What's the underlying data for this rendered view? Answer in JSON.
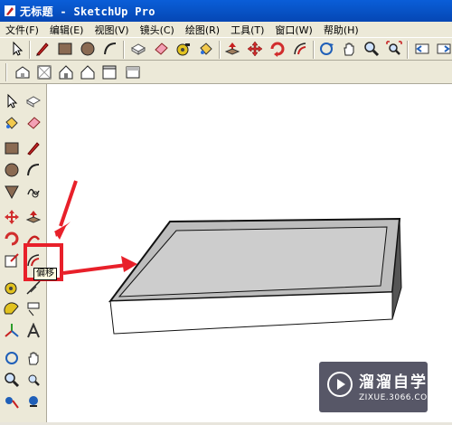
{
  "window": {
    "title": "无标题 - SketchUp Pro"
  },
  "menu": [
    "文件(F)",
    "编辑(E)",
    "视图(V)",
    "镜头(C)",
    "绘图(R)",
    "工具(T)",
    "窗口(W)",
    "帮助(H)"
  ],
  "tooltip": {
    "text": "偏移"
  },
  "watermark": {
    "title": "溜溜自学",
    "url": "ZIXUE.3066.COM"
  },
  "colors": {
    "titlebar": "#0547b4",
    "highlight": "#e8202a",
    "arrow": "#e8202a"
  },
  "toolbar_top_icons": [
    "select-icon",
    "pencil-icon",
    "rectangle-icon",
    "circle-icon",
    "arc-icon",
    "make-component-icon",
    "eraser-icon",
    "paint-bucket-icon",
    "push-pull-icon",
    "move-icon",
    "rotate-icon",
    "offset-icon",
    "orbit-icon",
    "pan-icon",
    "zoom-icon",
    "zoom-extents-icon",
    "previous-view-icon",
    "next-view-icon"
  ],
  "toolbar_views_icons": [
    "iso-view-icon",
    "top-view-icon",
    "front-view-icon",
    "right-view-icon",
    "back-view-icon"
  ]
}
